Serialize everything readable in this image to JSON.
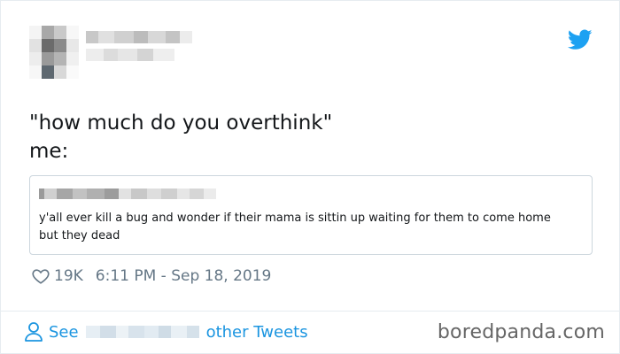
{
  "colors": {
    "twitter_blue": "#1da1f2",
    "link_blue": "#1b95e0",
    "text_dark": "#14171a",
    "text_muted": "#657786",
    "border": "#ccd6dd"
  },
  "tweet": {
    "text": "\"how much do you overthink\"\nme:",
    "quoted": {
      "text": "y'all ever kill a bug and wonder if their mama is sittin up waiting for them to come home but they dead"
    },
    "likes": "19K",
    "timestamp": "6:11 PM - Sep 18, 2019"
  },
  "footer": {
    "see_label": "See",
    "other_tweets_label": "other Tweets"
  },
  "watermark": "boredpanda.com",
  "icons": {
    "logo": "twitter-bird-icon",
    "like": "heart-icon",
    "profile": "person-icon"
  }
}
